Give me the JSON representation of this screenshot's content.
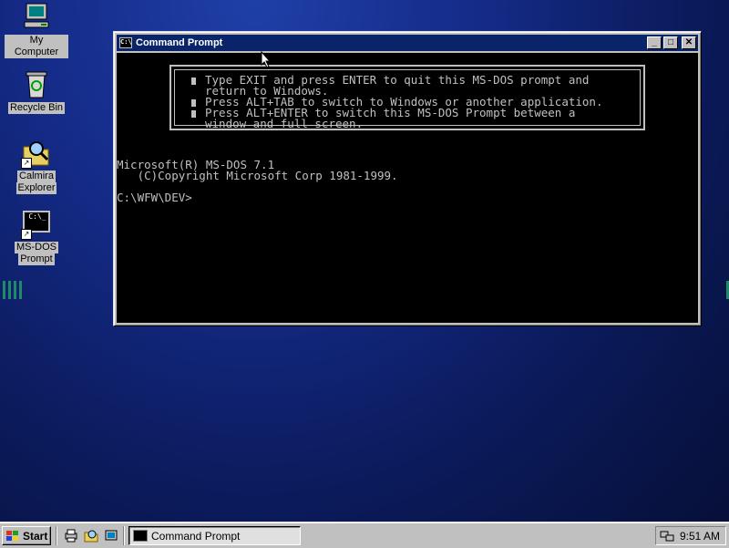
{
  "desktop": {
    "icons": [
      {
        "label": "My Computer",
        "icon": "my-computer-icon"
      },
      {
        "label": "Recycle Bin",
        "icon": "recycle-bin-icon"
      },
      {
        "label": "Calmira Explorer",
        "line1": "Calmira",
        "line2": "Explorer",
        "icon": "magnifier-folder-icon"
      },
      {
        "label": "MS-DOS Prompt",
        "line1": "MS-DOS",
        "line2": "Prompt",
        "icon": "msdos-prompt-icon",
        "glyph": "C:\\_"
      }
    ]
  },
  "window": {
    "title": "Command Prompt",
    "buttons": {
      "minimize": "_",
      "maximize": "□",
      "close": "✕"
    },
    "notice": [
      "Type EXIT and press ENTER to quit this MS-DOS prompt and",
      "return to Windows.",
      "Press ALT+TAB to switch to Windows or another application.",
      "Press ALT+ENTER to switch this MS-DOS Prompt between a",
      "window and full screen."
    ],
    "console": {
      "line1": "Microsoft(R) MS-DOS 7.1",
      "line2": "   (C)Copyright Microsoft Corp 1981-1999.",
      "prompt": "C:\\WFW\\DEV>"
    }
  },
  "taskbar": {
    "start_label": "Start",
    "quick_launch": [
      "printer-icon",
      "explorer-icon",
      "folder-icon"
    ],
    "active_task": "Command Prompt",
    "clock": "9:51 AM",
    "tray_icon": "network-icon"
  },
  "colors": {
    "titlebar": "#0a246a",
    "desktop": "#142a86",
    "console_bg": "#000000",
    "console_fg": "#c0c0c0",
    "chrome": "#c0c0c0"
  }
}
